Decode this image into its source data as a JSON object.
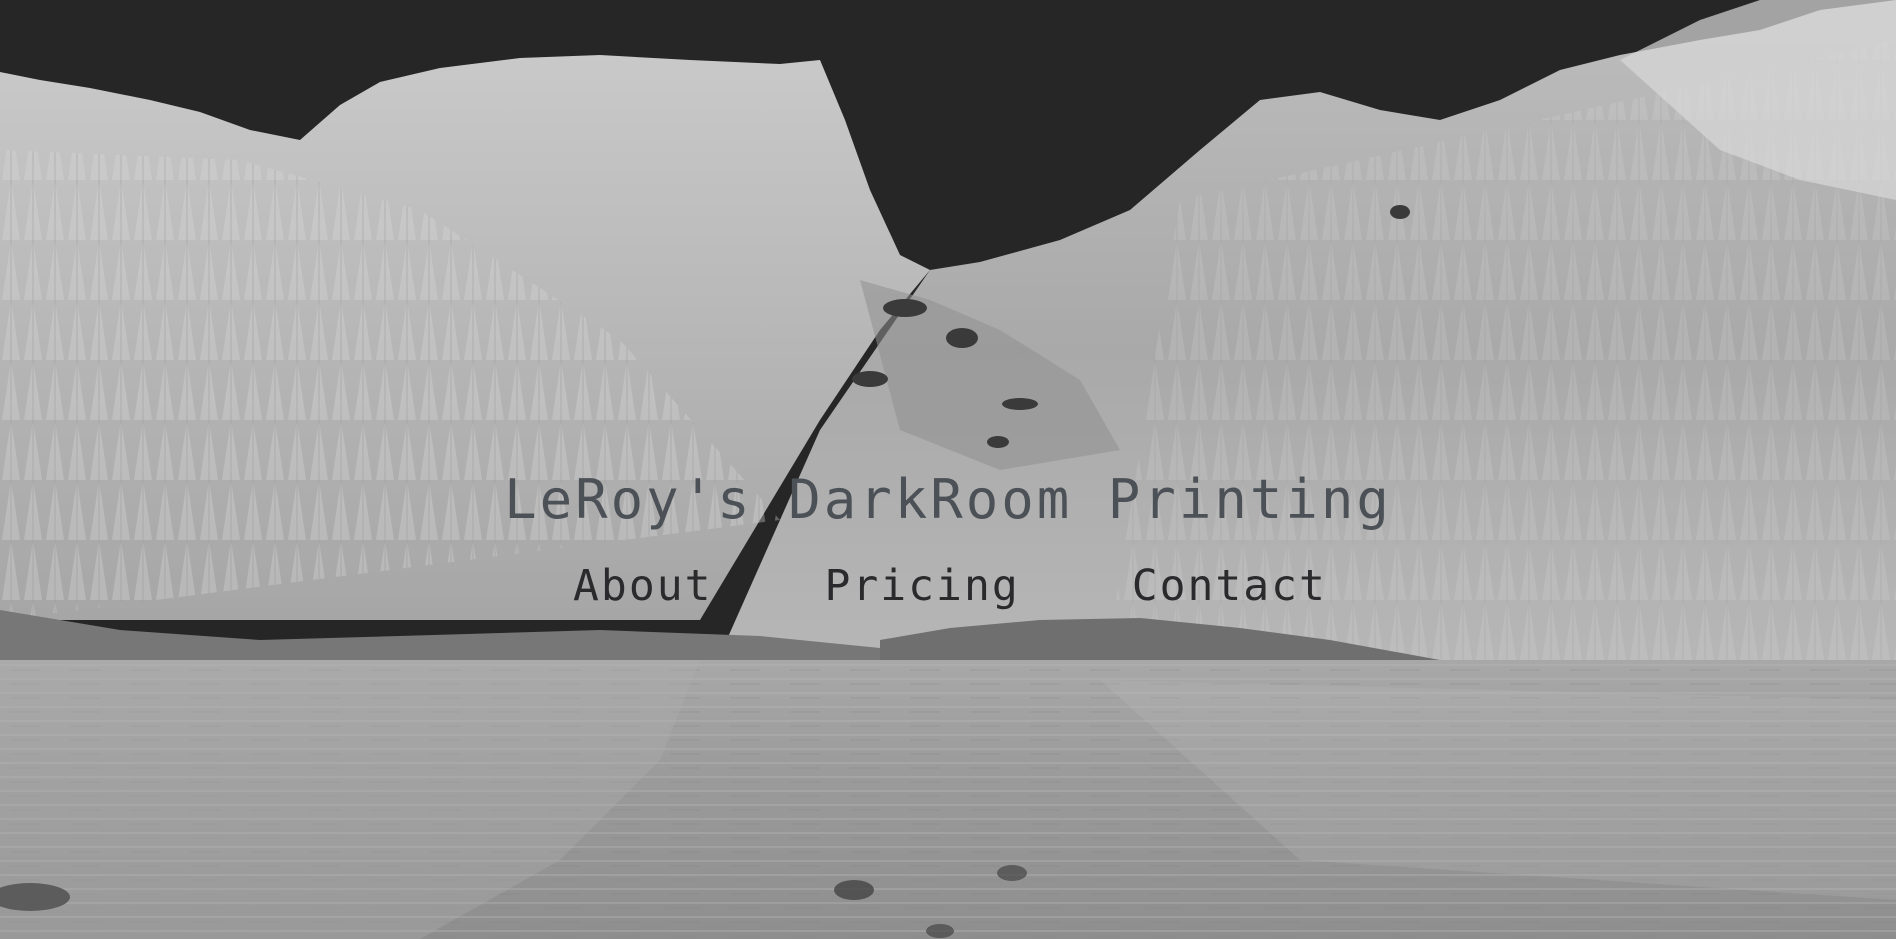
{
  "site": {
    "title": "LeRoy's DarkRoom Printing"
  },
  "nav": {
    "items": [
      {
        "label": "About"
      },
      {
        "label": "Pricing"
      },
      {
        "label": "Contact"
      }
    ]
  },
  "colors": {
    "sky": "#262626",
    "title": "#4b5156",
    "nav_text": "#2a2a2c"
  },
  "background": {
    "image": "inverted-mountain-lake-photo"
  }
}
